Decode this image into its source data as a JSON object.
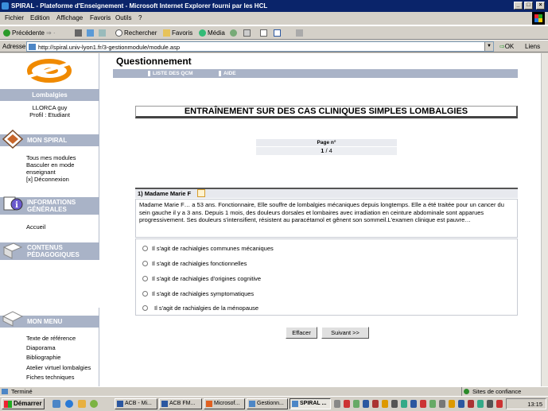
{
  "window": {
    "title": "SPIRAL - Plateforme d'Enseignement - Microsoft Internet Explorer fourni par les HCL"
  },
  "menu": [
    "Fichier",
    "Edition",
    "Affichage",
    "Favoris",
    "Outils",
    "?"
  ],
  "toolbar": {
    "back": "Précédente",
    "search": "Rechercher",
    "favorites": "Favoris",
    "media": "Média"
  },
  "address": {
    "label": "Adresse",
    "url": "http://spiral.univ-lyon1.fr/3-gestionmodule/module.asp",
    "go": "OK",
    "links": "Liens"
  },
  "sidebar": {
    "module": "Lombalgies",
    "user_name": "LLORCA guy",
    "user_profile": "Profil : Etudiant",
    "sections": [
      {
        "title": "MON SPIRAL",
        "icon": "diamond-icon",
        "items": [
          "Tous mes modules",
          "Basculer en mode enseignant",
          "[x]  Déconnexion"
        ]
      },
      {
        "title_line1": "INFORMATIONS",
        "title_line2": "GÉNÉRALES",
        "icon": "info-icon",
        "items": [
          "Accueil"
        ]
      },
      {
        "title_line1": "CONTENUS",
        "title_line2": "PÉDAGOGIQUES",
        "icon": "book-icon",
        "items": []
      },
      {
        "title": "MON MENU",
        "icon": "books-icon",
        "items": [
          "Texte de référence",
          "Diaporama",
          "Bibliographie",
          "Atelier virtuel lombalgies",
          "Fiches techniques"
        ]
      }
    ]
  },
  "main": {
    "title": "Questionnement",
    "nav": [
      "LISTE DES QCM",
      "AIDE"
    ],
    "banner": "ENTRAÎNEMENT SUR DES CAS CLINIQUES SIMPLES LOMBALGIES",
    "page_label": "Page n°",
    "page_current": "1",
    "page_total": " / 4",
    "question_title": "1) Madame Marie F",
    "question_text": "Madame Marie F… a 53 ans. Fonctionnaire, Elle souffre de lombalgies mécaniques depuis longtemps. Elle a été traitée pour un cancer du sein gauche il y a 3 ans. Depuis 1 mois, des douleurs dorsales et lombaires avec irradiation en ceinture abdominale sont apparues progressivement. Ses douleurs s'intensifient, résistent au paracétamol et gênent son sommeil.L'examen clinique est pauvre…",
    "answers": [
      "Il s'agit de rachialgies communes mécaniques",
      "Il s'agit de rachialgies fonctionnelles",
      "Il s'agit de rachialgies d'origines cognitive",
      "Il s'agit de rachialgies symptomatiques",
      "Il s'agit de rachialgies de la ménopause"
    ],
    "btn_clear": "Effacer",
    "btn_next": "Suivant >>"
  },
  "status": {
    "text": "Terminé",
    "zone": "Sites de confiance"
  },
  "taskbar": {
    "start": "Démarrer",
    "tasks": [
      "ACB - Mi...",
      "ACB FM...",
      "Microsof...",
      "Gestionn...",
      "SPIRAL ..."
    ],
    "clock": "13:15"
  },
  "colors": {
    "sidebar_band": "#a9b3c7",
    "titlebar": "#0a246a",
    "logo_orange": "#f08a00"
  }
}
